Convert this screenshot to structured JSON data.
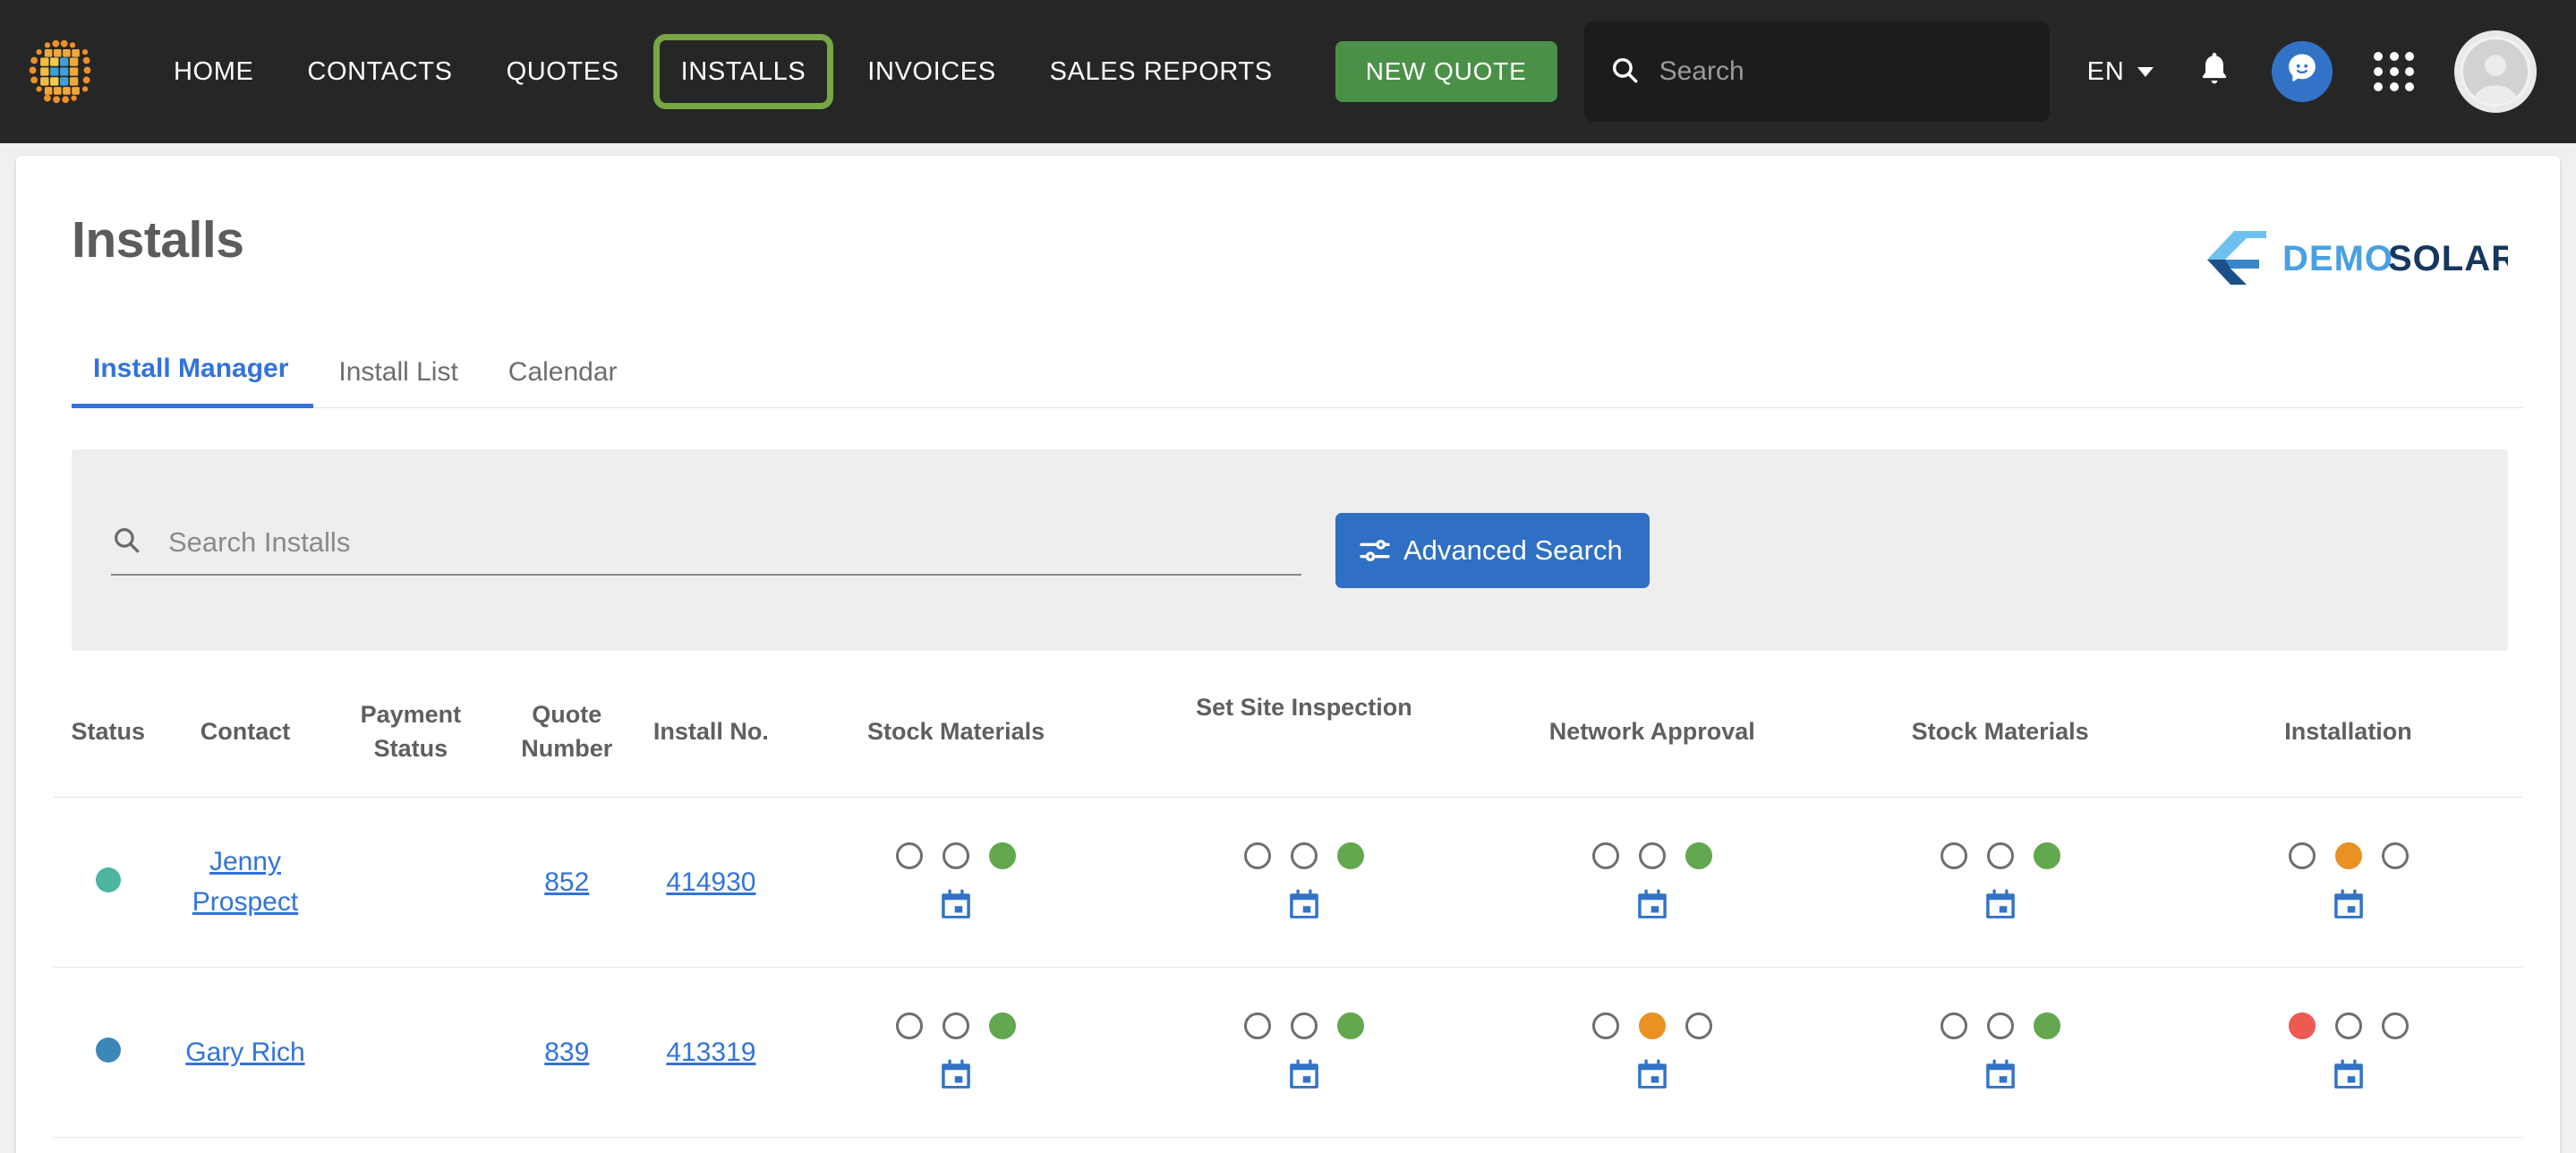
{
  "navbar": {
    "logo_icon": "solar-array-logo-icon",
    "links": [
      {
        "label": "HOME",
        "active": false
      },
      {
        "label": "CONTACTS",
        "active": false
      },
      {
        "label": "QUOTES",
        "active": false
      },
      {
        "label": "INSTALLS",
        "active": true
      },
      {
        "label": "INVOICES",
        "active": false
      },
      {
        "label": "SALES REPORTS",
        "active": false
      }
    ],
    "new_quote_label": "NEW QUOTE",
    "search_placeholder": "Search",
    "search_value": "",
    "search_icon": "search-icon",
    "language": "EN",
    "notifications_icon": "bell-icon",
    "chat_icon": "chat-support-icon",
    "apps_icon": "apps-grid-icon",
    "avatar_icon": "user-avatar-icon",
    "colors": {
      "bar_bg": "#262626",
      "active_outline": "#76a743",
      "new_quote_bg": "#4a9147",
      "chat_bg": "#3273c8"
    }
  },
  "page": {
    "title": "Installs",
    "brand_logo": {
      "text_light": "DEMO",
      "text_dark": "SOLAR",
      "icon": "demosolar-logo-icon"
    }
  },
  "tabs": [
    {
      "label": "Install Manager",
      "selected": true
    },
    {
      "label": "Install List",
      "selected": false
    },
    {
      "label": "Calendar",
      "selected": false
    }
  ],
  "search": {
    "placeholder": "Search Installs",
    "value": "",
    "icon": "search-icon",
    "advanced_button_label": "Advanced Search",
    "advanced_button_icon": "filter-sliders-icon",
    "advanced_button_color": "#2f6fc4"
  },
  "table": {
    "headers": [
      "Status",
      "Contact",
      "Payment Status",
      "Quote Number",
      "Install No.",
      "Stock Materials",
      "Set Site Inspection",
      "Network Approval",
      "Stock Materials",
      "Installation"
    ],
    "rows": [
      {
        "status_color": "#4db6a0",
        "contact": "Jenny Prospect",
        "payment_status": "",
        "quote_number": "852",
        "install_no": "414930",
        "stages": [
          {
            "name": "Stock Materials",
            "dots": [
              "empty",
              "empty",
              "green"
            ],
            "calendar": true
          },
          {
            "name": "Set Site Inspection",
            "dots": [
              "empty",
              "empty",
              "green"
            ],
            "calendar": true
          },
          {
            "name": "Network Approval",
            "dots": [
              "empty",
              "empty",
              "green"
            ],
            "calendar": true
          },
          {
            "name": "Stock Materials",
            "dots": [
              "empty",
              "empty",
              "green"
            ],
            "calendar": true
          },
          {
            "name": "Installation",
            "dots": [
              "empty",
              "orange",
              "empty"
            ],
            "calendar": true
          }
        ]
      },
      {
        "status_color": "#3d87b8",
        "contact": "Gary Rich",
        "payment_status": "",
        "quote_number": "839",
        "install_no": "413319",
        "stages": [
          {
            "name": "Stock Materials",
            "dots": [
              "empty",
              "empty",
              "green"
            ],
            "calendar": true
          },
          {
            "name": "Set Site Inspection",
            "dots": [
              "empty",
              "empty",
              "green"
            ],
            "calendar": true
          },
          {
            "name": "Network Approval",
            "dots": [
              "empty",
              "orange",
              "empty"
            ],
            "calendar": true
          },
          {
            "name": "Stock Materials",
            "dots": [
              "empty",
              "empty",
              "green"
            ],
            "calendar": true
          },
          {
            "name": "Installation",
            "dots": [
              "red",
              "empty",
              "empty"
            ],
            "calendar": true
          }
        ]
      }
    ],
    "dot_colors": {
      "green": "#63a74f",
      "orange": "#ea9123",
      "red": "#ec5a51",
      "empty_border": "#6e6e6e"
    },
    "calendar_icon": "calendar-icon",
    "calendar_color": "#3273c8"
  }
}
